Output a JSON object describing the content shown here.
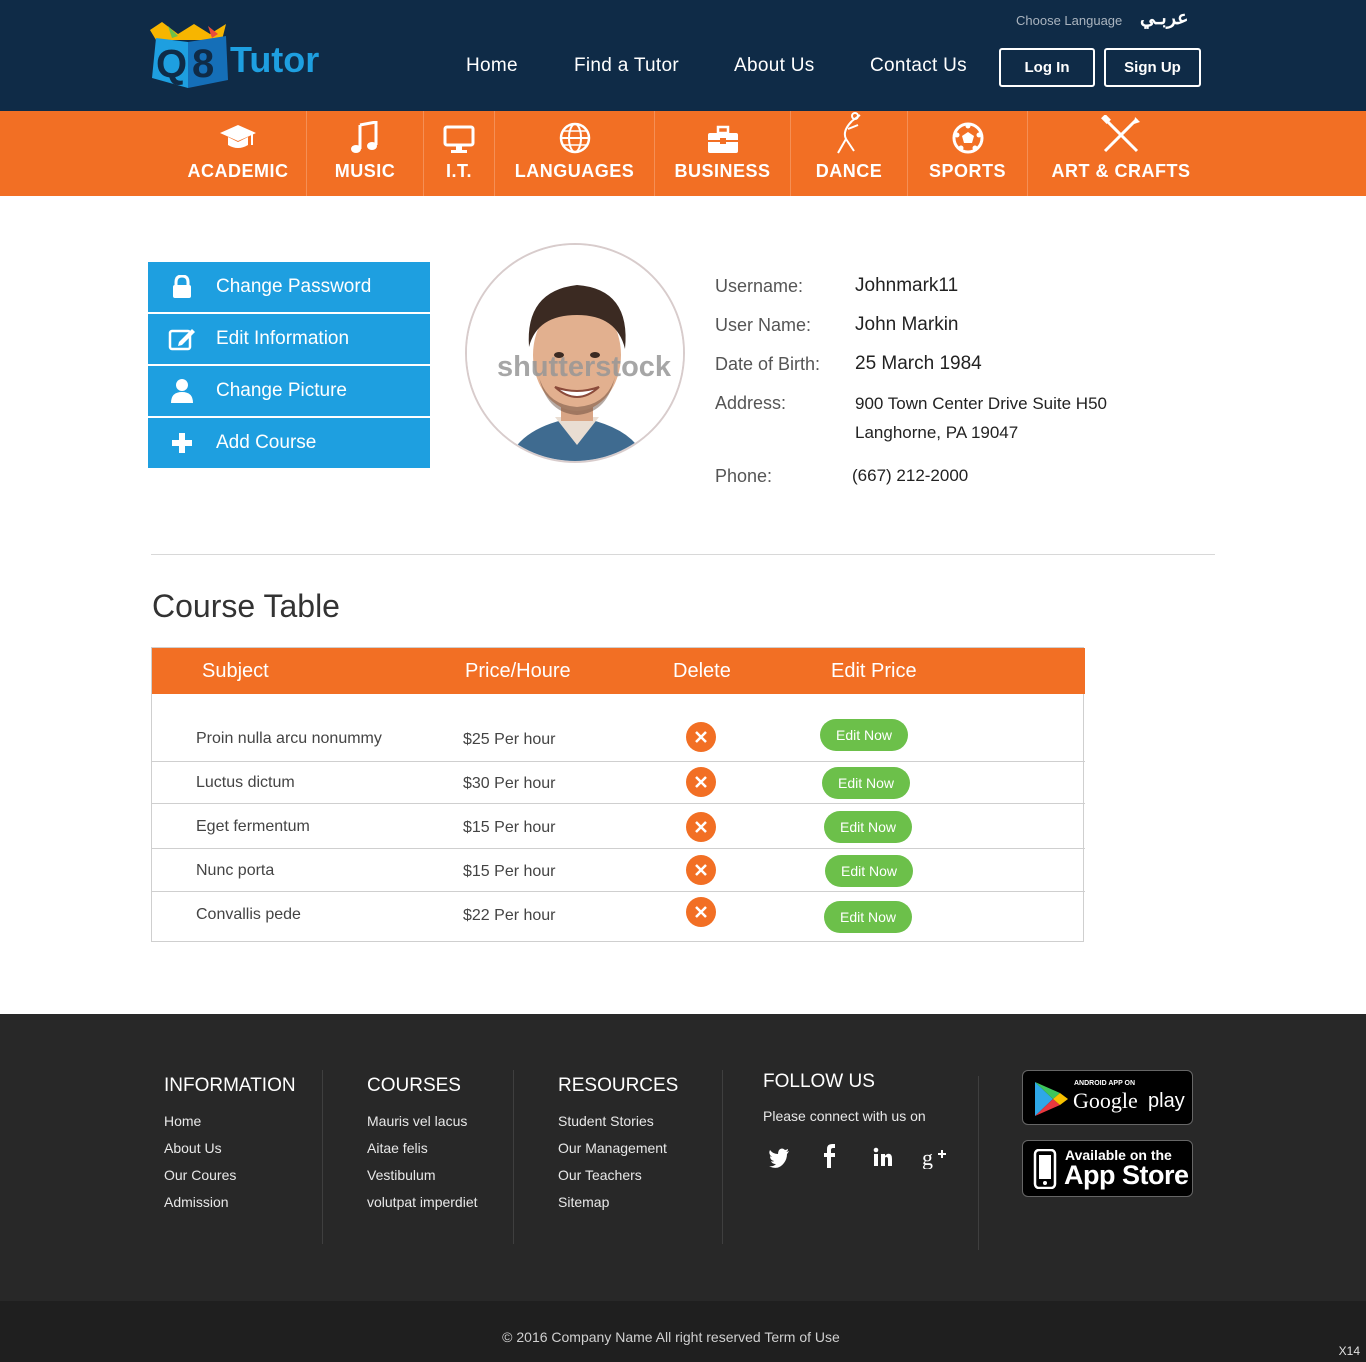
{
  "header": {
    "logo_text": "Q8Tutor",
    "choose_language": "Choose Language",
    "arabic_label": "عربـي",
    "nav": [
      "Home",
      "Find a Tutor",
      "About Us",
      "Contact Us"
    ],
    "login_label": "Log In",
    "signup_label": "Sign Up"
  },
  "categories": [
    {
      "label": "ACADEMIC",
      "icon": "graduation-cap-icon"
    },
    {
      "label": "MUSIC",
      "icon": "music-note-icon"
    },
    {
      "label": "I.T.",
      "icon": "monitor-icon"
    },
    {
      "label": "LANGUAGES",
      "icon": "globe-icon"
    },
    {
      "label": "BUSINESS",
      "icon": "briefcase-icon"
    },
    {
      "label": "DANCE",
      "icon": "dancer-icon"
    },
    {
      "label": "SPORTS",
      "icon": "soccer-ball-icon"
    },
    {
      "label": "ART & CRAFTS",
      "icon": "crossed-tools-icon"
    }
  ],
  "sidebar": [
    {
      "label": "Change Password",
      "icon": "lock-icon"
    },
    {
      "label": "Edit Information",
      "icon": "edit-icon"
    },
    {
      "label": "Change Picture",
      "icon": "user-icon"
    },
    {
      "label": "Add Course",
      "icon": "plus-icon"
    }
  ],
  "avatar": {
    "watermark": "shutterstock"
  },
  "profile": {
    "username_label": "Username:",
    "username": "Johnmark11",
    "username_full_label": "User Name:",
    "name": "John Markin",
    "dob_label": "Date of Birth:",
    "dob": "25 March 1984",
    "address_label": "Address:",
    "address_line1": "900 Town Center Drive Suite H50",
    "address_line2": "Langhorne, PA 19047",
    "phone_label": "Phone:",
    "phone": "(667) 212-2000"
  },
  "course_table": {
    "title": "Course Table",
    "headers": [
      "Subject",
      "Price/Houre",
      "Delete",
      "Edit Price"
    ],
    "rows": [
      {
        "subject": "Proin nulla arcu nonummy",
        "price": "$25 Per hour",
        "action": "Edit Now"
      },
      {
        "subject": "Luctus dictum",
        "price": "$30 Per hour",
        "action": "Edit Now"
      },
      {
        "subject": "Eget fermentum",
        "price": "$15 Per hour",
        "action": "Edit Now"
      },
      {
        "subject": "Nunc porta",
        "price": "$15 Per hour",
        "action": "Edit Now"
      },
      {
        "subject": "Convallis pede",
        "price": "$22 Per hour",
        "action": "Edit Now"
      }
    ]
  },
  "footer": {
    "information": {
      "title": "INFORMATION",
      "links": [
        "Home",
        "About Us",
        "Our Coures",
        "Admission"
      ]
    },
    "courses": {
      "title": "COURSES",
      "links": [
        "Mauris vel lacus",
        "Aitae felis",
        "Vestibulum",
        "volutpat imperdiet"
      ]
    },
    "resources": {
      "title": "RESOURCES",
      "links": [
        "Student Stories",
        "Our Management",
        "Our Teachers",
        "Sitemap"
      ]
    },
    "follow": {
      "title": "FOLLOW US",
      "text": "Please connect with us on",
      "icons": [
        "twitter-icon",
        "facebook-icon",
        "linkedin-icon",
        "google-plus-icon"
      ]
    },
    "google_play": {
      "small": "ANDROID APP ON",
      "big_1": "Google",
      "big_2": "play"
    },
    "app_store": {
      "small": "Available on the",
      "big": "App Store"
    },
    "copyright": "© 2016 Company Name  All right reserved  Term of Use",
    "corner": "X14"
  },
  "colors": {
    "navy": "#0f2b47",
    "orange": "#f26f24",
    "blue": "#1e9fe0",
    "green": "#6cc04a",
    "footer": "#282828"
  }
}
